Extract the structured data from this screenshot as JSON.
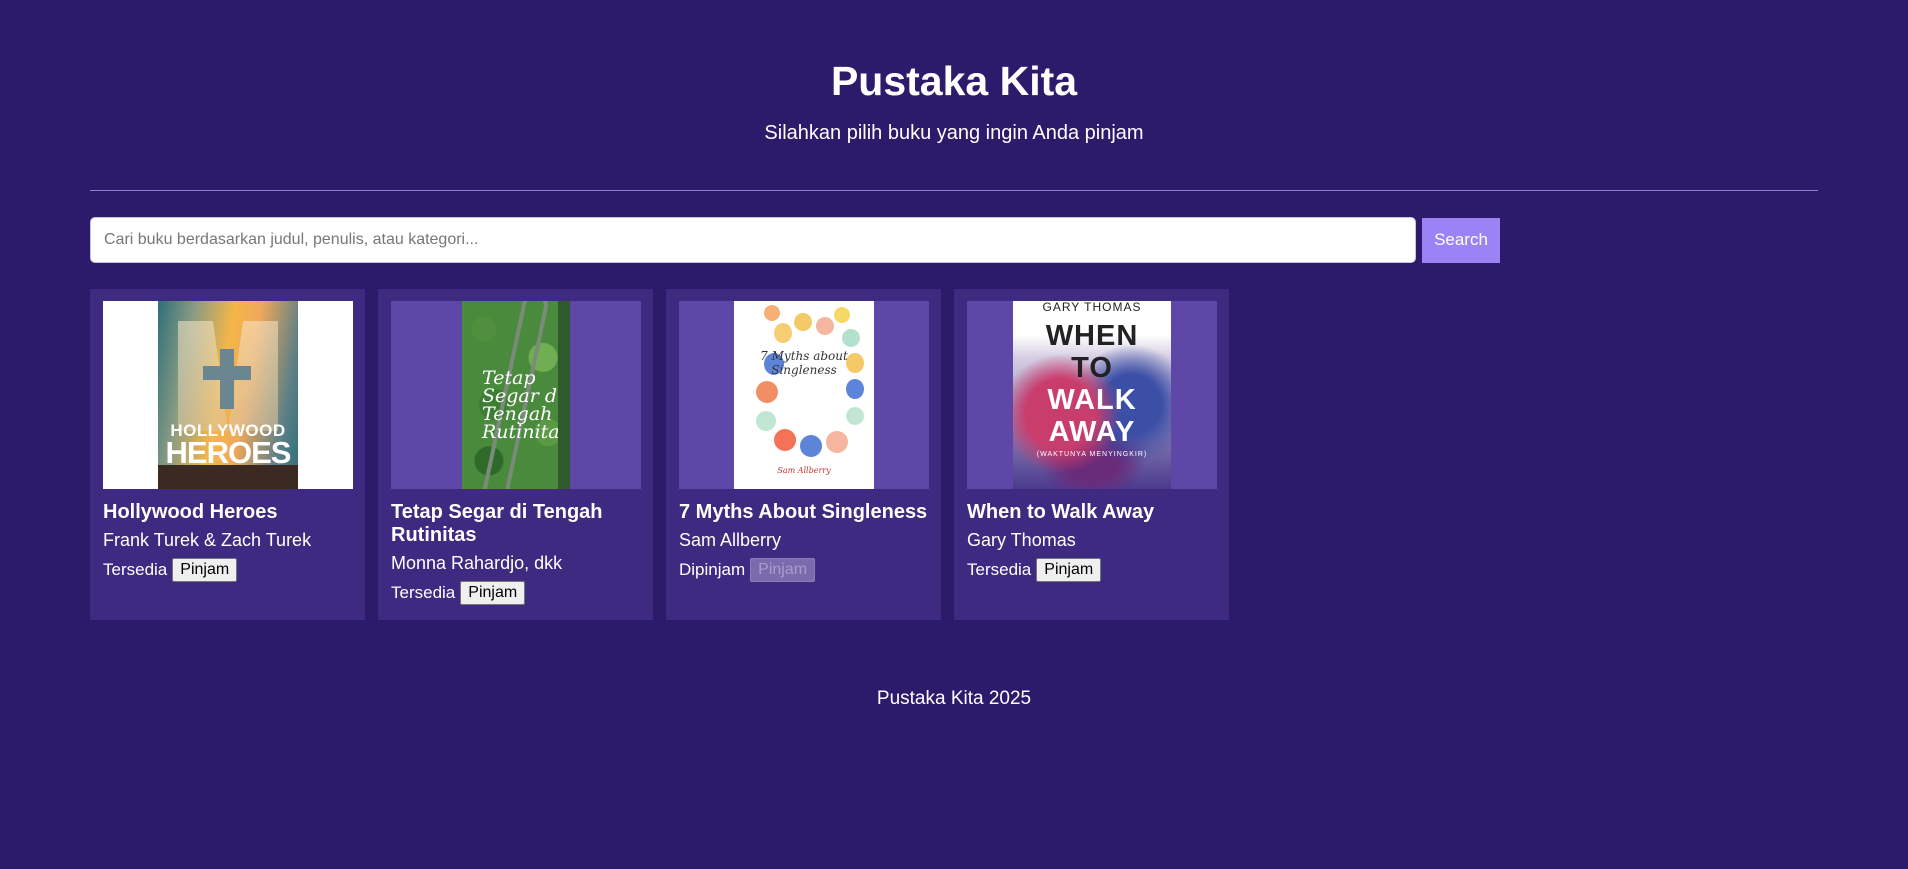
{
  "header": {
    "title": "Pustaka Kita",
    "subtitle": "Silahkan pilih buku yang ingin Anda pinjam"
  },
  "search": {
    "placeholder": "Cari buku berdasarkan judul, penulis, atau kategori...",
    "value": "",
    "button_label": "Search"
  },
  "books": [
    {
      "title": "Hollywood Heroes",
      "author": "Frank Turek & Zach Turek",
      "status": "Tersedia",
      "button_label": "Pinjam",
      "button_enabled": true,
      "cover": {
        "line1": "HOLLYWOOD",
        "line2": "HEROES"
      }
    },
    {
      "title": "Tetap Segar di Tengah Rutinitas",
      "author": "Monna Rahardjo, dkk",
      "status": "Tersedia",
      "button_label": "Pinjam",
      "button_enabled": true,
      "cover": {
        "line1": "Tetap Segar di Tengah Rutinitas"
      }
    },
    {
      "title": "7 Myths About Singleness",
      "author": "Sam Allberry",
      "status": "Dipinjam",
      "button_label": "Pinjam",
      "button_enabled": false,
      "cover": {
        "line1": "7 Myths about Singleness",
        "line2": "Sam Allberry"
      }
    },
    {
      "title": "When to Walk Away",
      "author": "Gary Thomas",
      "status": "Tersedia",
      "button_label": "Pinjam",
      "button_enabled": true,
      "cover": {
        "author": "GARY THOMAS",
        "line1": "WHEN",
        "line2": "TO",
        "line3": "WALK",
        "line4": "AWAY",
        "line5": "(WAKTUNYA MENYINGKIR)"
      }
    }
  ],
  "footer": {
    "text": "Pustaka Kita 2025"
  },
  "colors": {
    "background": "#2c1a6b",
    "card": "#3e2a80",
    "accent": "#9b82f5"
  }
}
